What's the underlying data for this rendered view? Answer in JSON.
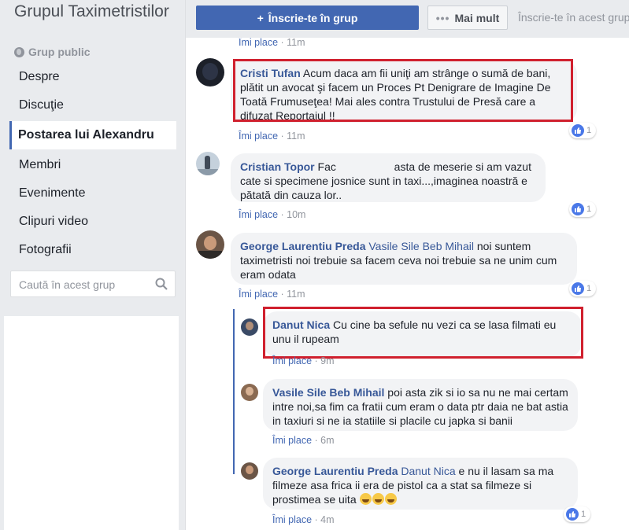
{
  "sidebar": {
    "group_title": "Grupul Taximetristilor",
    "group_type": "Grup public",
    "nav": [
      "Despre",
      "Discuţie",
      "Postarea lui Alexandru",
      "Membri",
      "Evenimente",
      "Clipuri video",
      "Fotografii"
    ],
    "active_index": 2,
    "search_placeholder": "Caută în acest grup"
  },
  "topbar": {
    "join_label": "Înscrie-te în grup",
    "more_label": "Mai mult",
    "join_hint": "Înscrie-te în acest grup"
  },
  "comments": {
    "top_meta": {
      "like": "Îmi place",
      "time": "11m"
    },
    "c1": {
      "author": "Cristi Tufan",
      "text": "Acum daca am fii uniţi am strânge o sumă de bani, plătit un avocat şi facem un Proces Pt Denigrare de Imagine De Toată Frumuseţea! Mai ales contra Trustului de Presă care a difuzat Reportajul !!",
      "like": "Îmi place",
      "time": "11m",
      "reactions": "1"
    },
    "c2": {
      "author": "Cristian Topor",
      "text1": "Fac",
      "text2": "asta de meserie si am vazut cate si specimene josnice sunt in taxi...,imaginea noastră e pătată din cauza lor..",
      "like": "Îmi place",
      "time": "10m",
      "reactions": "1"
    },
    "c3": {
      "author": "George Laurentiu Preda",
      "mention": "Vasile Sile Beb Mihail",
      "text": "noi suntem taximetristi noi trebuie sa facem ceva noi trebuie sa ne unim cum eram odata",
      "like": "Îmi place",
      "time": "11m",
      "reactions": "1"
    },
    "r1": {
      "author": "Danut Nica",
      "text": "Cu cine ba sefule nu vezi ca se lasa filmati eu unu il rupeam",
      "like": "Îmi place",
      "time": "9m"
    },
    "r2": {
      "author": "Vasile Sile Beb Mihail",
      "text": "poi asta zik si io sa nu ne mai certam intre noi,sa fim ca fratii cum eram o data ptr daia ne bat astia in taxiuri si ne ia statiile si placile cu japka si banii",
      "like": "Îmi place",
      "time": "6m"
    },
    "r3": {
      "author": "George Laurentiu Preda",
      "mention": "Danut Nica",
      "text": "e nu il lasam sa ma filmeze asa frica ii era de pistol ca a stat sa filmeze si prostimea se uita",
      "like": "Îmi place",
      "time": "4m",
      "reactions": "1"
    }
  },
  "colors": {
    "accent": "#4267b2",
    "highlight": "#d0202e",
    "link": "#385898"
  }
}
